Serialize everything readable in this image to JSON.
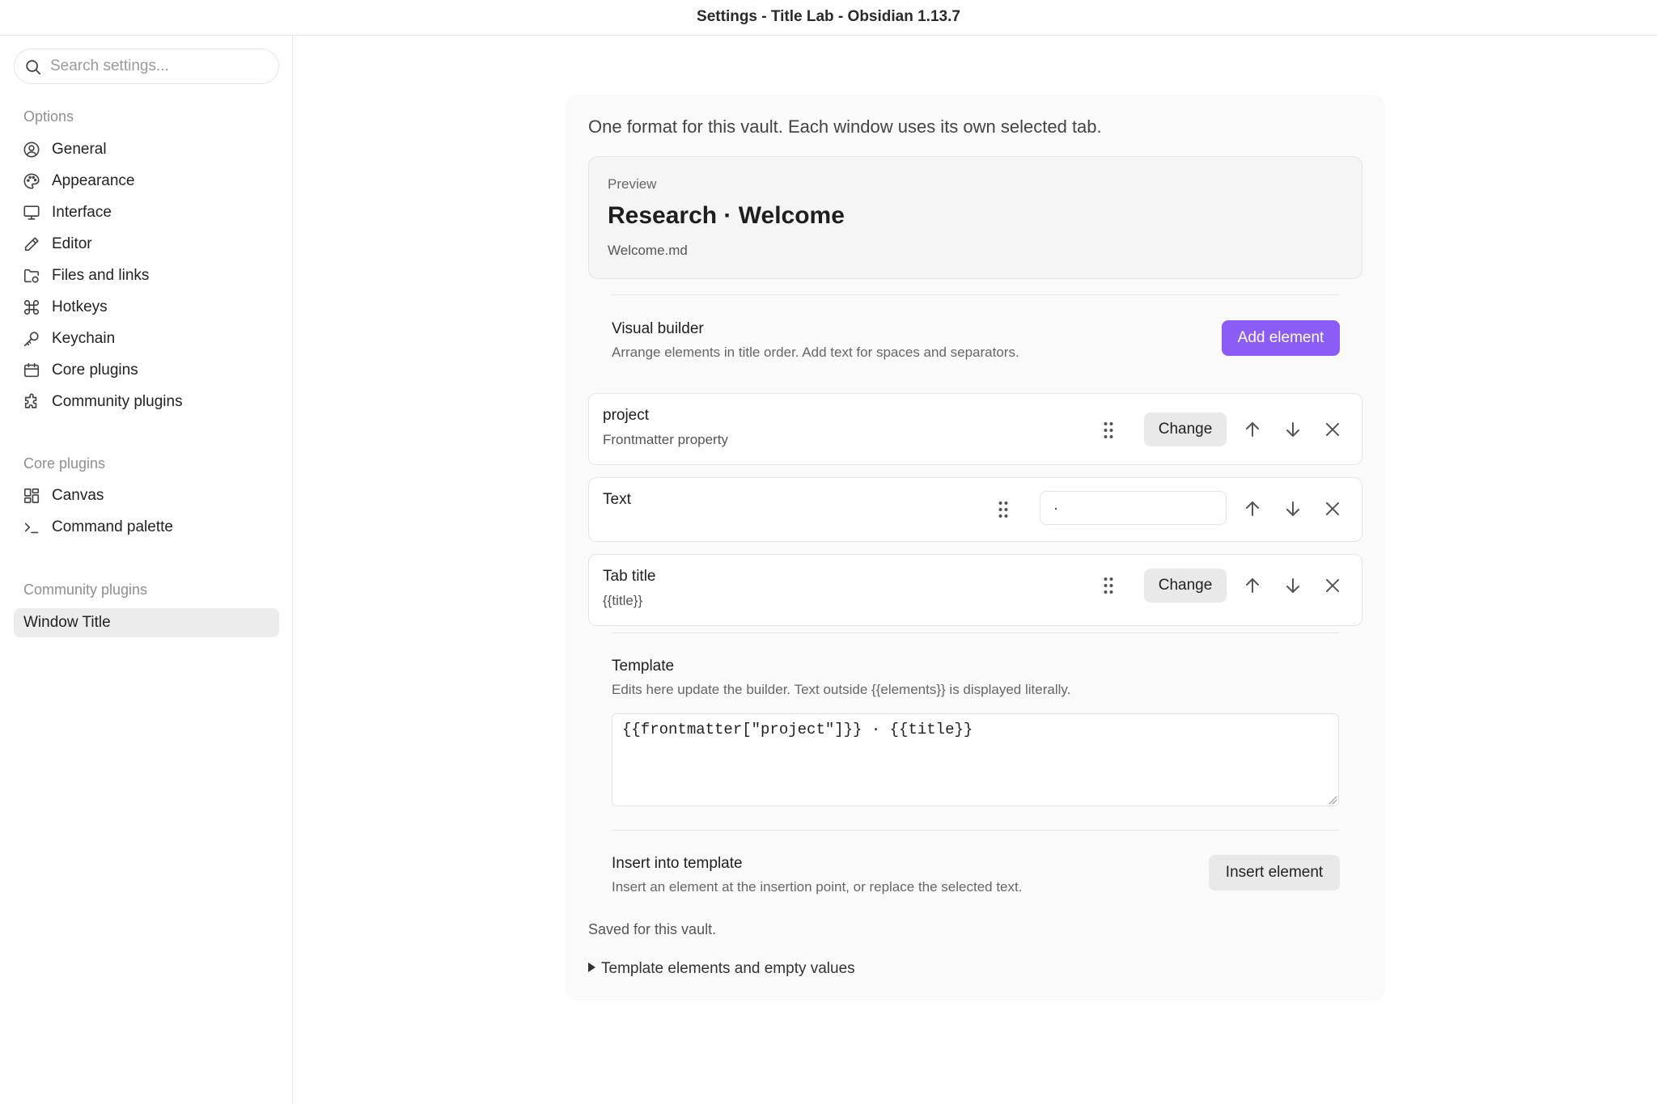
{
  "window": {
    "title": "Settings - Title Lab - Obsidian 1.13.7"
  },
  "search": {
    "placeholder": "Search settings..."
  },
  "sidebar": {
    "options_title": "Options",
    "options": [
      {
        "label": "General",
        "icon": "user-circle-icon"
      },
      {
        "label": "Appearance",
        "icon": "palette-icon"
      },
      {
        "label": "Interface",
        "icon": "monitor-icon"
      },
      {
        "label": "Editor",
        "icon": "pencil-icon"
      },
      {
        "label": "Files and links",
        "icon": "folder-link-icon"
      },
      {
        "label": "Hotkeys",
        "icon": "command-icon"
      },
      {
        "label": "Keychain",
        "icon": "key-icon"
      },
      {
        "label": "Core plugins",
        "icon": "plugin-box-icon"
      },
      {
        "label": "Community plugins",
        "icon": "puzzle-icon"
      }
    ],
    "core_title": "Core plugins",
    "core": [
      {
        "label": "Canvas",
        "icon": "canvas-grid-icon"
      },
      {
        "label": "Command palette",
        "icon": "terminal-icon"
      }
    ],
    "community_title": "Community plugins",
    "community": [
      {
        "label": "Window Title",
        "active": true
      }
    ]
  },
  "main": {
    "intro": "One format for this vault. Each window uses its own selected tab.",
    "preview": {
      "label": "Preview",
      "title": "Research · Welcome",
      "file": "Welcome.md"
    },
    "builder": {
      "name": "Visual builder",
      "desc": "Arrange elements in title order. Add text for spaces and separators.",
      "add_label": "Add element"
    },
    "elements": [
      {
        "name": "project",
        "sub": "Frontmatter property",
        "change_label": "Change"
      },
      {
        "name": "Text",
        "value": "·"
      },
      {
        "name": "Tab title",
        "sub": "{{title}}",
        "change_label": "Change"
      }
    ],
    "template": {
      "name": "Template",
      "desc": "Edits here update the builder. Text outside {{elements}} is displayed literally.",
      "value": "{{frontmatter[\"project\"]}} · {{title}}"
    },
    "insert": {
      "name": "Insert into template",
      "desc": "Insert an element at the insertion point, or replace the selected text.",
      "button_label": "Insert element"
    },
    "saved": "Saved for this vault.",
    "details_summary": "Template elements and empty values"
  },
  "colors": {
    "accent": "#8b5cf6",
    "panel_bg": "#fafafa",
    "active_nav": "#ececec"
  }
}
